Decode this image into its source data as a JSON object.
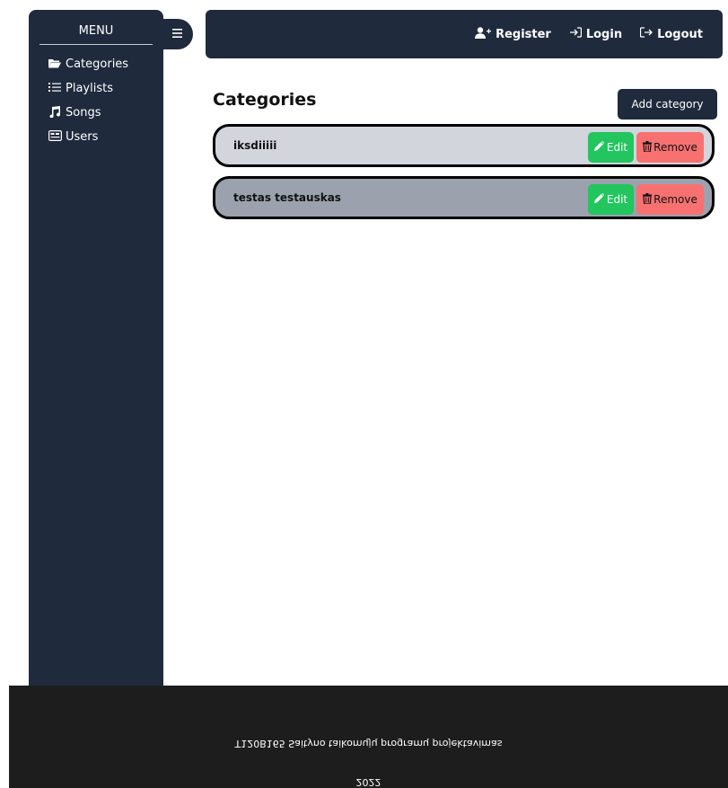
{
  "sidebar": {
    "title": "MENU",
    "items": [
      {
        "label": "Categories",
        "icon": "folder-open-icon"
      },
      {
        "label": "Playlists",
        "icon": "list-icon"
      },
      {
        "label": "Songs",
        "icon": "music-icon"
      },
      {
        "label": "Users",
        "icon": "id-card-icon"
      }
    ]
  },
  "toggle": {
    "icon": "hamburger-icon"
  },
  "header": {
    "links": [
      {
        "label": "Register",
        "icon": "user-plus-icon"
      },
      {
        "label": "Login",
        "icon": "sign-in-icon"
      },
      {
        "label": "Logout",
        "icon": "sign-out-icon"
      }
    ]
  },
  "main": {
    "title": "Categories",
    "add_label": "Add category",
    "categories": [
      {
        "name": "iksdiiiii",
        "edit_label": "Edit",
        "remove_label": "Remove"
      },
      {
        "name": "testas testauskas",
        "edit_label": "Edit",
        "remove_label": "Remove"
      }
    ]
  },
  "footer": {
    "line1": "T120B165 Saityno taikomųjų programų projektavimas",
    "line2": "2022"
  },
  "colors": {
    "navy": "#1f2a3d",
    "edit": "#22c55e",
    "remove": "#f87171",
    "row1": "#d2d5dc",
    "row2": "#9ba2ae",
    "footer": "#1d1d1d"
  }
}
